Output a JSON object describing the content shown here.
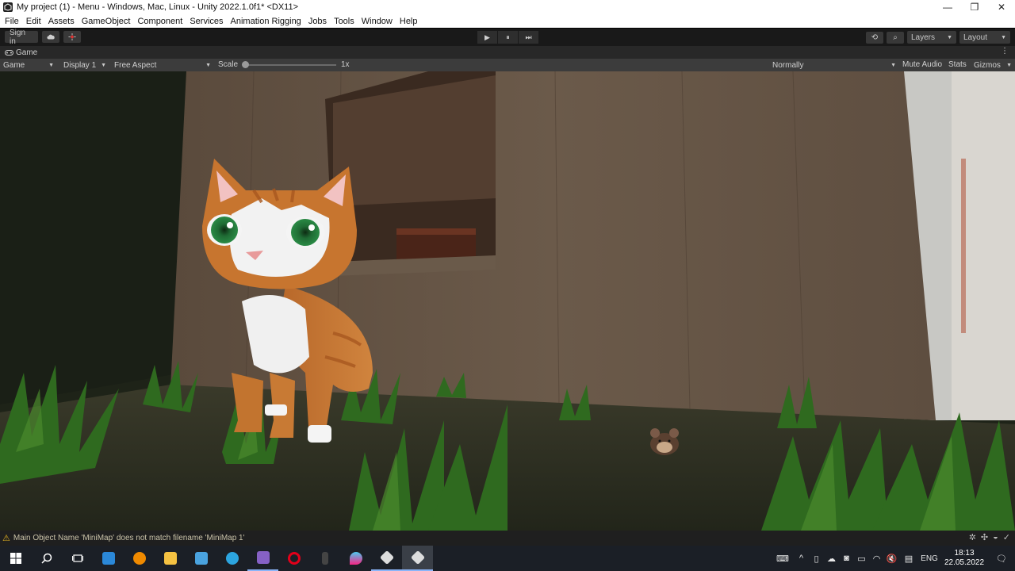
{
  "window": {
    "title": "My project (1) - Menu - Windows, Mac, Linux - Unity 2022.1.0f1* <DX11>",
    "controls": {
      "minimize": "—",
      "maximize": "❐",
      "close": "✕"
    }
  },
  "menu": [
    "File",
    "Edit",
    "Assets",
    "GameObject",
    "Component",
    "Services",
    "Animation Rigging",
    "Jobs",
    "Tools",
    "Window",
    "Help"
  ],
  "toolbar": {
    "sign_in": "Sign in",
    "cloud_icon": "cloud-icon",
    "collab_icon": "collab-icon",
    "play_icon": "▶",
    "pause_icon": "⏸",
    "step_icon": "⏭",
    "history_icon": "⟲",
    "search_icon": "⌕",
    "layers": "Layers",
    "layout": "Layout"
  },
  "game_tab": {
    "label": "Game",
    "menu_icon": "⋮"
  },
  "game_controls": {
    "mode": "Game",
    "display": "Display 1",
    "aspect": "Free Aspect",
    "scale_label": "Scale",
    "scale_value": "1x",
    "scale_fraction": 0.0,
    "vsync": "Normally",
    "mute_audio": "Mute Audio",
    "stats": "Stats",
    "gizmos": "Gizmos"
  },
  "status": {
    "warning_icon": "warning-icon",
    "message": "Main Object Name 'MiniMap' does not match filename 'MiniMap 1'"
  },
  "taskbar": {
    "clock_time": "18:13",
    "clock_date": "22.05.2022",
    "language": "ENG",
    "apps": [
      {
        "name": "start-icon",
        "color": "#ffffff"
      },
      {
        "name": "search-icon",
        "color": "#ffffff"
      },
      {
        "name": "task-view-icon",
        "color": "#ffffff"
      },
      {
        "name": "mail-icon",
        "color": "#2b88d8"
      },
      {
        "name": "avast-icon",
        "color": "#f08a00"
      },
      {
        "name": "file-explorer-icon",
        "color": "#f5c242"
      },
      {
        "name": "store-icon",
        "color": "#4aa3df"
      },
      {
        "name": "telegram-icon",
        "color": "#2ca5e0"
      },
      {
        "name": "visual-studio-icon",
        "color": "#8661c5"
      },
      {
        "name": "opera-icon",
        "color": "#e2001a"
      },
      {
        "name": "app-icon",
        "color": "#444444"
      },
      {
        "name": "gradient-app-icon",
        "color": "#9b5de5"
      },
      {
        "name": "unity-hub-icon",
        "color": "#dddddd"
      },
      {
        "name": "unity-editor-icon",
        "color": "#dddddd"
      }
    ]
  },
  "colors": {
    "editor_bg": "#191919",
    "accent_warning": "#e0b020",
    "taskbar": "#1b1f26"
  }
}
